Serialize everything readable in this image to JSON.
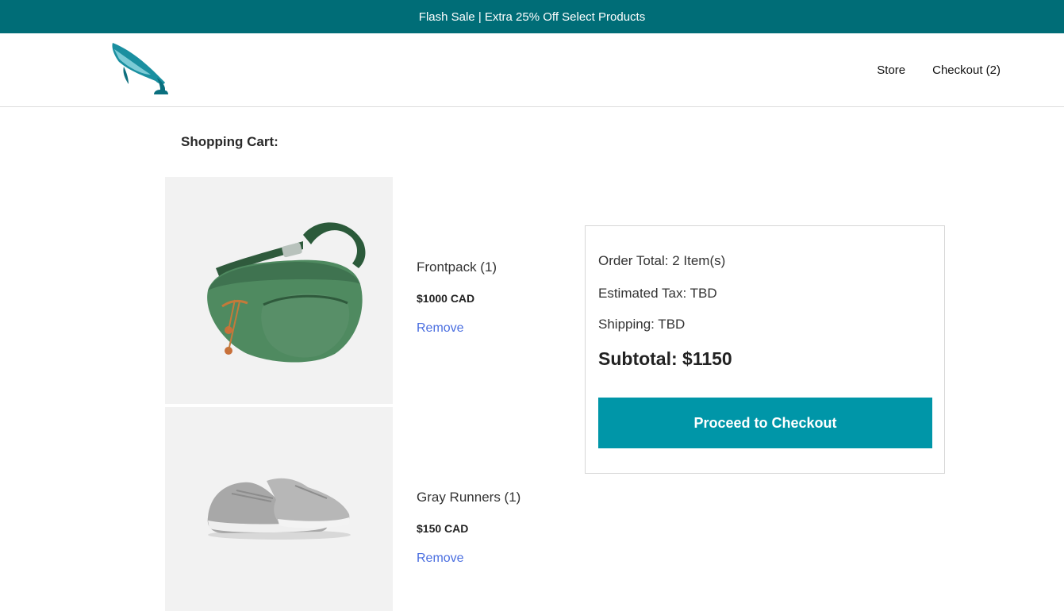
{
  "banner": {
    "text": "Flash Sale | Extra 25% Off Select Products"
  },
  "header": {
    "logo_icon": "whale-logo-icon",
    "nav": {
      "store_label": "Store",
      "checkout_label": "Checkout (2)"
    }
  },
  "cart": {
    "title": "Shopping Cart:",
    "items": [
      {
        "name": "Frontpack (1)",
        "price": "$1000 CAD",
        "remove_label": "Remove",
        "image_icon": "green-fanny-pack-image"
      },
      {
        "name": "Gray Runners (1)",
        "price": "$150 CAD",
        "remove_label": "Remove",
        "image_icon": "gray-sneakers-image"
      }
    ]
  },
  "summary": {
    "order_total": "Order Total: 2 Item(s)",
    "estimated_tax": "Estimated Tax: TBD",
    "shipping": "Shipping: TBD",
    "subtotal": "Subtotal: $1150",
    "checkout_button": "Proceed to Checkout"
  },
  "colors": {
    "banner_bg": "#006d77",
    "button_bg": "#0096a8",
    "link": "#4a6ee0",
    "image_bg": "#f2f2f2"
  }
}
